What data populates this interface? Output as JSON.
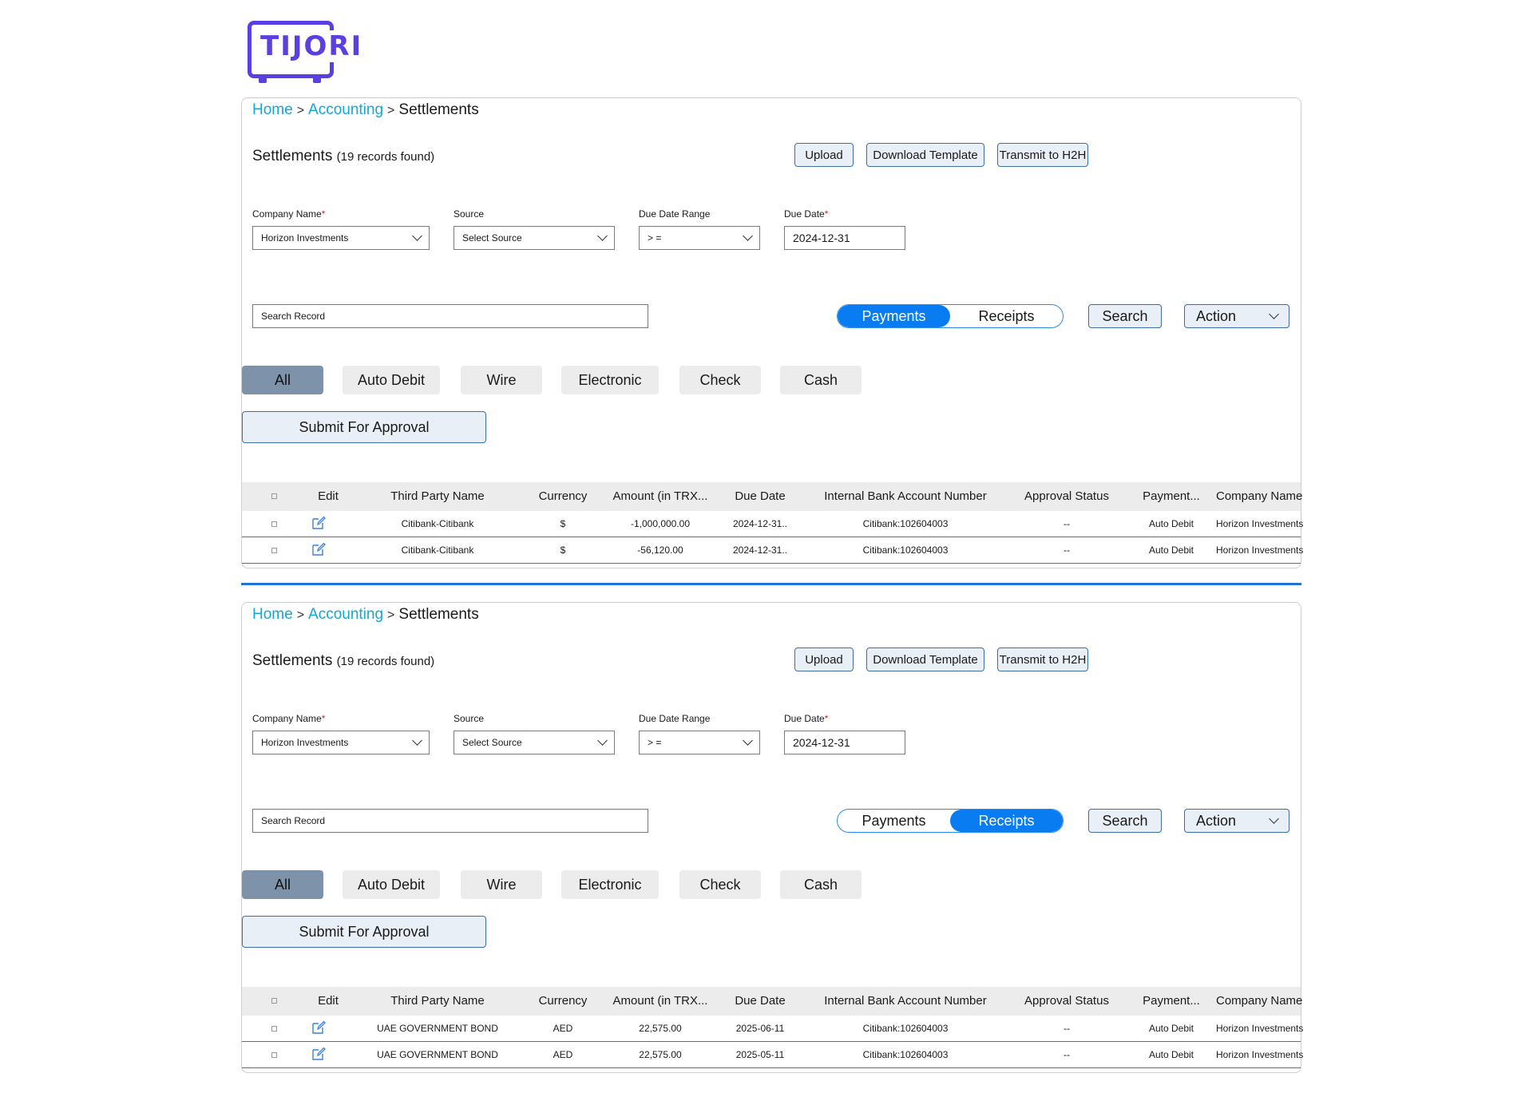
{
  "brand": {
    "logo_text": "TIJORI",
    "color": "#5b3fe0"
  },
  "colors": {
    "link": "#13a7d8",
    "toggle_active": "#0a7cf2",
    "filter_active": "#7e93aa",
    "divider": "#1e74d6",
    "required": "#e02020"
  },
  "panels": [
    {
      "breadcrumb": {
        "home": "Home",
        "accounting": "Accounting",
        "current": "Settlements"
      },
      "title": "Settlements",
      "count": "(19 records found)",
      "toolbar": {
        "upload": "Upload",
        "download_template": "Download Template",
        "transmit": "Transmit to H2H"
      },
      "filters": {
        "company_label": "Company Name",
        "company_value": "Horizon Investments",
        "source_label": "Source",
        "source_value": "Select Source",
        "range_label": "Due Date Range",
        "range_value": "> =",
        "date_label": "Due Date",
        "date_value": "2024-12-31"
      },
      "search_placeholder": "Search Record",
      "toggle": {
        "payments": "Payments",
        "receipts": "Receipts",
        "active": "payments"
      },
      "search_button": "Search",
      "action_button": "Action",
      "types": [
        "All",
        "Auto Debit",
        "Wire",
        "Electronic",
        "Check",
        "Cash"
      ],
      "submit": "Submit For Approval",
      "columns": [
        "Edit",
        "Third Party Name",
        "Currency",
        "Amount (in TRX...",
        "Due Date",
        "Internal Bank Account Number",
        "Approval Status",
        "Payment...",
        "Company Name"
      ],
      "rows": [
        {
          "third_party": "Citibank-Citibank",
          "currency": "$",
          "amount": "-1,000,000.00",
          "due": "2024-12-31..",
          "account": "Citibank:102604003",
          "approval": "--",
          "payment": "Auto Debit",
          "company": "Horizon Investments"
        },
        {
          "third_party": "Citibank-Citibank",
          "currency": "$",
          "amount": "-56,120.00",
          "due": "2024-12-31..",
          "account": "Citibank:102604003",
          "approval": "--",
          "payment": "Auto Debit",
          "company": "Horizon Investments"
        }
      ]
    },
    {
      "breadcrumb": {
        "home": "Home",
        "accounting": "Accounting",
        "current": "Settlements"
      },
      "title": "Settlements",
      "count": "(19 records found)",
      "toolbar": {
        "upload": "Upload",
        "download_template": "Download Template",
        "transmit": "Transmit to H2H"
      },
      "filters": {
        "company_label": "Company Name",
        "company_value": "Horizon Investments",
        "source_label": "Source",
        "source_value": "Select Source",
        "range_label": "Due Date Range",
        "range_value": "> =",
        "date_label": "Due Date",
        "date_value": "2024-12-31"
      },
      "search_placeholder": "Search Record",
      "toggle": {
        "payments": "Payments",
        "receipts": "Receipts",
        "active": "receipts"
      },
      "search_button": "Search",
      "action_button": "Action",
      "types": [
        "All",
        "Auto Debit",
        "Wire",
        "Electronic",
        "Check",
        "Cash"
      ],
      "submit": "Submit For Approval",
      "columns": [
        "Edit",
        "Third Party Name",
        "Currency",
        "Amount (in TRX...",
        "Due Date",
        "Internal Bank Account Number",
        "Approval Status",
        "Payment...",
        "Company Name"
      ],
      "rows": [
        {
          "third_party": "UAE GOVERNMENT BOND",
          "currency": "AED",
          "amount": "22,575.00",
          "due": "2025-06-11",
          "account": "Citibank:102604003",
          "approval": "--",
          "payment": "Auto Debit",
          "company": "Horizon Investments"
        },
        {
          "third_party": "UAE GOVERNMENT BOND",
          "currency": "AED",
          "amount": "22,575.00",
          "due": "2025-05-11",
          "account": "Citibank:102604003",
          "approval": "--",
          "payment": "Auto Debit",
          "company": "Horizon Investments"
        }
      ]
    }
  ]
}
